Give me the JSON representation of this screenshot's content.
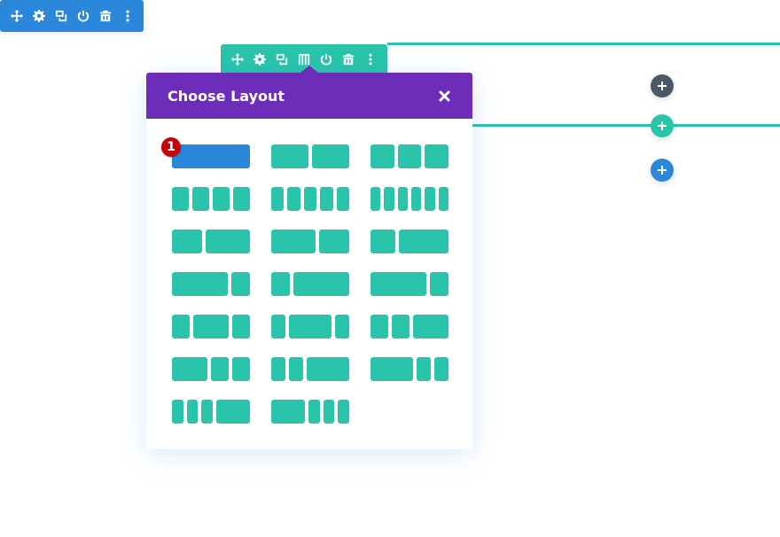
{
  "section_toolbar": {
    "color": "#2b87da",
    "icons": [
      "move-icon",
      "gear-icon",
      "duplicate-icon",
      "power-icon",
      "trash-icon",
      "more-icon"
    ]
  },
  "row_toolbar": {
    "color": "#29c4a9",
    "icons": [
      "move-icon",
      "gear-icon",
      "duplicate-icon",
      "columns-icon",
      "power-icon",
      "trash-icon",
      "more-icon"
    ]
  },
  "modal": {
    "title": "Choose Layout",
    "header_color": "#6c2eb9",
    "close_label": "×",
    "badge": "1",
    "layouts": [
      [
        [
          1
        ],
        [
          1,
          1
        ],
        [
          1,
          1,
          1
        ]
      ],
      [
        [
          1,
          1,
          1,
          1
        ],
        [
          1,
          1,
          1,
          1,
          1
        ],
        [
          1,
          1,
          1,
          1,
          1,
          1
        ]
      ],
      [
        [
          2,
          3
        ],
        [
          3,
          2
        ],
        [
          1,
          2
        ]
      ],
      [
        [
          3,
          1
        ],
        [
          1,
          3
        ],
        [
          3,
          1
        ]
      ],
      [
        [
          1,
          2,
          1
        ],
        [
          1,
          3,
          1
        ],
        [
          1,
          1,
          2
        ]
      ],
      [
        [
          2,
          1,
          1
        ],
        [
          1,
          1,
          3
        ],
        [
          3,
          1,
          1
        ]
      ],
      [
        [
          1,
          1,
          1,
          3
        ],
        [
          3,
          1,
          1,
          1
        ]
      ]
    ],
    "selected": [
      0,
      0
    ]
  },
  "add_buttons": {
    "module": {
      "label": "+",
      "color": "#4c5866"
    },
    "row": {
      "label": "+",
      "color": "#29c4a9"
    },
    "section": {
      "label": "+",
      "color": "#2b87da"
    }
  }
}
